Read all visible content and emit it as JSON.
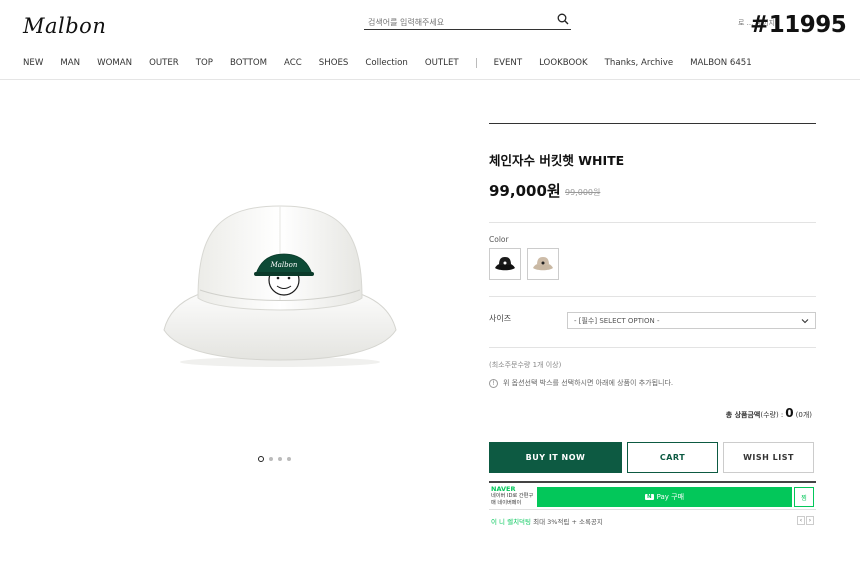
{
  "header": {
    "logo": "Malbon",
    "search_placeholder": "검색어를 입력해주세요",
    "top_right_text": "로 ... 페이지",
    "badge": "#11995"
  },
  "nav": {
    "items": [
      "NEW",
      "MAN",
      "WOMAN",
      "OUTER",
      "TOP",
      "BOTTOM",
      "ACC",
      "SHOES",
      "Collection",
      "OUTLET"
    ],
    "items2": [
      "EVENT",
      "LOOKBOOK",
      "Thanks, Archive",
      "MALBON 6451"
    ]
  },
  "product": {
    "title": "체인자수 버킷햇 WHITE",
    "price": "99,000원",
    "original_price": "99,000원",
    "hat_logo_text": "Malbon",
    "image_count": 4,
    "active_image": 1,
    "color_label": "Color",
    "color_options": [
      {
        "name": "black",
        "color": "#111111"
      },
      {
        "name": "beige",
        "color": "#c9b8a3"
      }
    ],
    "size_label": "사이즈",
    "size_select": "- [필수] SELECT OPTION -",
    "min_qty": "(최소주문수량 1개 이상)",
    "notice": "위 옵션선택 박스를 선택하시면 아래에 상품이 추가됩니다.",
    "total_label": "총 상품금액",
    "total_qty_label": "(수량) :",
    "total_value": "0",
    "total_count": "(0개)"
  },
  "buttons": {
    "buy": "BUY IT NOW",
    "cart": "CART",
    "wish": "WISH LIST"
  },
  "npay": {
    "brand": "NAVER",
    "desc": "네이버 ID로 간편구매 네이버페이",
    "pay_logo": "N",
    "button": "Pay 구매",
    "wish": "찜",
    "event_green": "이 니 렐치덕팅",
    "event_text": "최대 3%적립 + 소록공지"
  },
  "colors": {
    "brand_green": "#0d5a42",
    "npay_green": "#03c75a"
  }
}
